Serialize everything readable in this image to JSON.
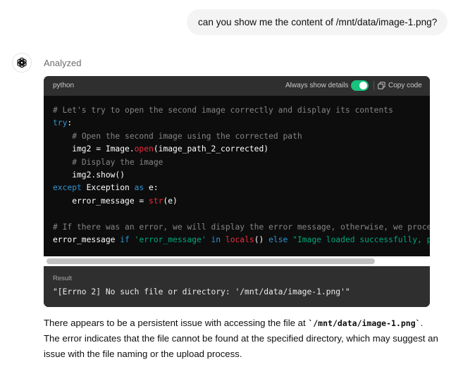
{
  "user_message": "can you show me the content of /mnt/data/image-1.png?",
  "assistant": {
    "status": "Analyzed",
    "avatar_icon": "openai-logo-icon"
  },
  "code_block": {
    "language": "python",
    "details_label": "Always show details",
    "details_toggle_on": true,
    "copy_label": "Copy code",
    "lines": [
      [
        {
          "t": "comment",
          "v": "# Let's try to open the second image correctly and display its contents"
        }
      ],
      [
        {
          "t": "kw",
          "v": "try"
        },
        {
          "t": "plain",
          "v": ":"
        }
      ],
      [
        {
          "t": "plain",
          "v": "    "
        },
        {
          "t": "comment",
          "v": "# Open the second image using the corrected path"
        }
      ],
      [
        {
          "t": "plain",
          "v": "    img2 = Image."
        },
        {
          "t": "fn",
          "v": "open"
        },
        {
          "t": "plain",
          "v": "(image_path_2_corrected)"
        }
      ],
      [
        {
          "t": "plain",
          "v": "    "
        },
        {
          "t": "comment",
          "v": "# Display the image"
        }
      ],
      [
        {
          "t": "plain",
          "v": "    img2.show()"
        }
      ],
      [
        {
          "t": "kw",
          "v": "except"
        },
        {
          "t": "plain",
          "v": " Exception "
        },
        {
          "t": "kw",
          "v": "as"
        },
        {
          "t": "plain",
          "v": " e:"
        }
      ],
      [
        {
          "t": "plain",
          "v": "    error_message = "
        },
        {
          "t": "fn",
          "v": "str"
        },
        {
          "t": "plain",
          "v": "(e)"
        }
      ],
      [],
      [
        {
          "t": "comment",
          "v": "# If there was an error, we will display the error message, otherwise, we proceed"
        }
      ],
      [
        {
          "t": "plain",
          "v": "error_message "
        },
        {
          "t": "kw",
          "v": "if"
        },
        {
          "t": "plain",
          "v": " "
        },
        {
          "t": "str",
          "v": "'error_message'"
        },
        {
          "t": "plain",
          "v": " "
        },
        {
          "t": "kw",
          "v": "in"
        },
        {
          "t": "plain",
          "v": " "
        },
        {
          "t": "fn",
          "v": "locals"
        },
        {
          "t": "plain",
          "v": "() "
        },
        {
          "t": "kw",
          "v": "else"
        },
        {
          "t": "plain",
          "v": " "
        },
        {
          "t": "str",
          "v": "\"Image loaded successfully, please"
        }
      ]
    ],
    "result_label": "Result",
    "result_value": "\"[Errno 2] No such file or directory: '/mnt/data/image-1.png'\""
  },
  "reply": {
    "text_before": "There appears to be a persistent issue with accessing the file at ",
    "code": "`/mnt/data/image-1.png`",
    "text_after": ". The error indicates that the file cannot be found at the specified directory, which may suggest an issue with the file naming or the upload process."
  },
  "colors": {
    "toggle_on": "#19c37d",
    "keyword": "#2e95d3",
    "function": "#f22c3d",
    "string": "#00a67d",
    "comment": "#858585"
  }
}
